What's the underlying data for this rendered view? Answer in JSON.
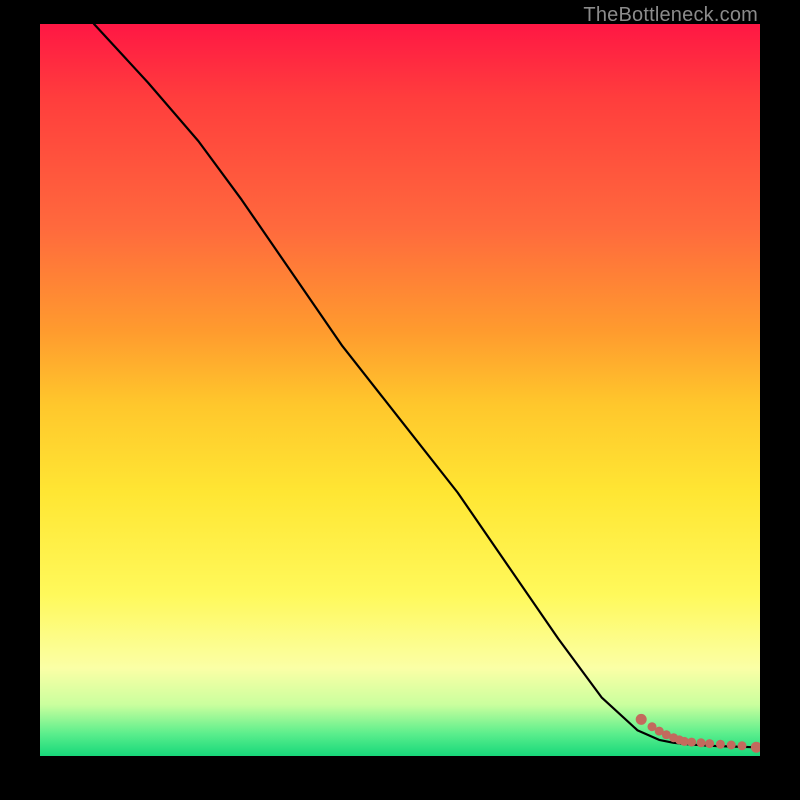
{
  "watermark": "TheBottleneck.com",
  "chart_data": {
    "type": "line",
    "title": "",
    "xlabel": "",
    "ylabel": "",
    "xlim": [
      0,
      100
    ],
    "ylim": [
      0,
      100
    ],
    "grid": false,
    "series": [
      {
        "name": "curve",
        "style": "line",
        "color": "#000000",
        "x": [
          7.5,
          15,
          22,
          28,
          35,
          42,
          50,
          58,
          65,
          72,
          78,
          83,
          86,
          88,
          90,
          93,
          96,
          99
        ],
        "y": [
          100,
          92,
          84,
          76,
          66,
          56,
          46,
          36,
          26,
          16,
          8,
          3.5,
          2.2,
          1.8,
          1.6,
          1.4,
          1.3,
          1.2
        ]
      },
      {
        "name": "points",
        "style": "scatter",
        "color": "#c36a5d",
        "x": [
          83.5,
          85.0,
          86.0,
          87.0,
          88.0,
          88.8,
          89.5,
          90.5,
          91.8,
          93.0,
          94.5,
          96.0,
          97.5,
          99.5
        ],
        "y": [
          5.0,
          4.0,
          3.4,
          2.9,
          2.5,
          2.2,
          2.0,
          1.9,
          1.8,
          1.7,
          1.6,
          1.5,
          1.4,
          1.2
        ]
      }
    ]
  }
}
